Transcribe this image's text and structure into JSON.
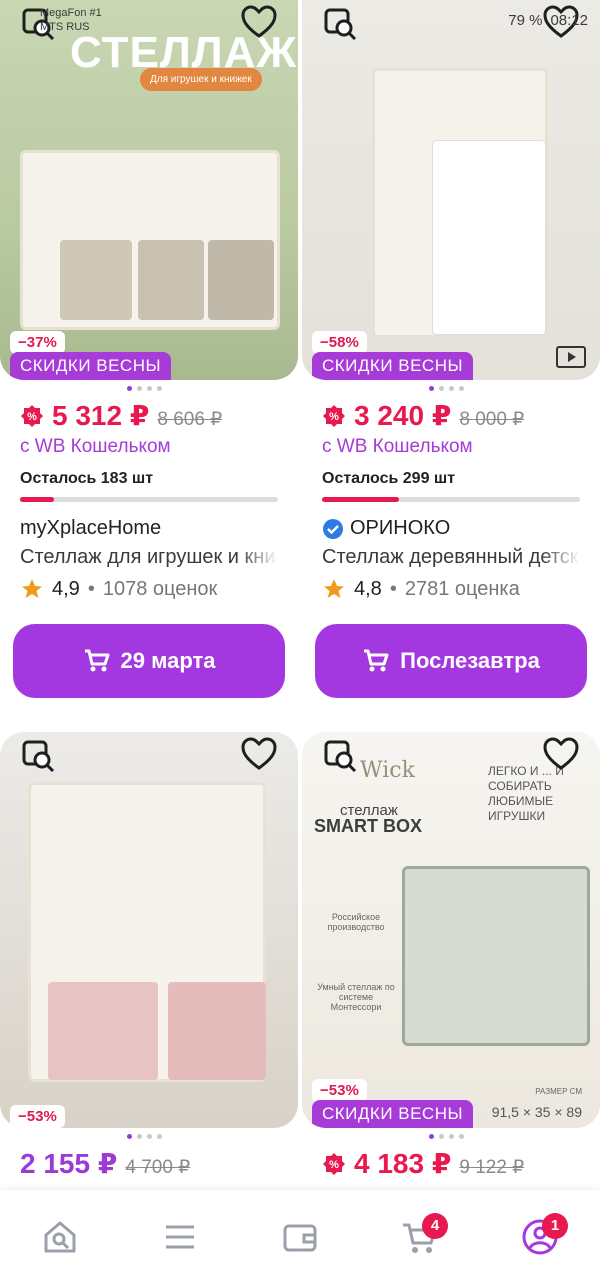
{
  "status_bar": {
    "carrier_1": "MegaFon #1",
    "carrier_2": "MTS RUS",
    "battery": "79 %",
    "time": "08:12"
  },
  "products": [
    {
      "image_heading": "СТЕЛЛАЖ",
      "image_tag": "Для игрушек и книжек",
      "discount": "−37%",
      "promo": "СКИДКИ ВЕСНЫ",
      "price": "5 312 ₽",
      "old_price": "8 606 ₽",
      "wallet": "с WB Кошельком",
      "stock": "Осталось 183 шт",
      "stock_fraction": 0.13,
      "brand": "myXplaceHome",
      "name": "Стеллаж для игрушек и книг",
      "rating": "4,9",
      "reviews": "1078 оценок",
      "cta": "29 марта"
    },
    {
      "discount": "−58%",
      "promo": "СКИДКИ ВЕСНЫ",
      "price": "3 240 ₽",
      "old_price": "8 000 ₽",
      "wallet": "с WB Кошельком",
      "stock": "Осталось 299 шт",
      "stock_fraction": 0.3,
      "brand": "ОРИНОКО",
      "name": "Стеллаж деревянный детский",
      "rating": "4,8",
      "reviews": "2781 оценка",
      "cta": "Послезавтра"
    },
    {
      "discount": "−53%",
      "price": "2 155 ₽",
      "old_price": "4 700 ₽"
    },
    {
      "image_brand": "Wick",
      "image_title_1": "стеллаж",
      "image_title_2": "SMART BOX",
      "image_slogan": "ЛЕГКО И ... И СОБИРАТЬ ЛЮБИМЫЕ ИГРУШКИ",
      "image_origin": "Российское производство",
      "image_montessori": "Умный стеллаж по системе Монтессори",
      "image_size_label": "РАЗМЕР СМ",
      "image_size": "91,5 × 35 × 89",
      "discount": "−53%",
      "promo": "СКИДКИ ВЕСНЫ",
      "price": "4 183 ₽",
      "old_price": "9 122 ₽"
    }
  ],
  "bottom_nav": {
    "cart_count": "4",
    "profile_count": "1"
  },
  "colors": {
    "accent": "#a338e0",
    "price_red": "#e8194f",
    "badge_purple": "#a63bd7"
  }
}
